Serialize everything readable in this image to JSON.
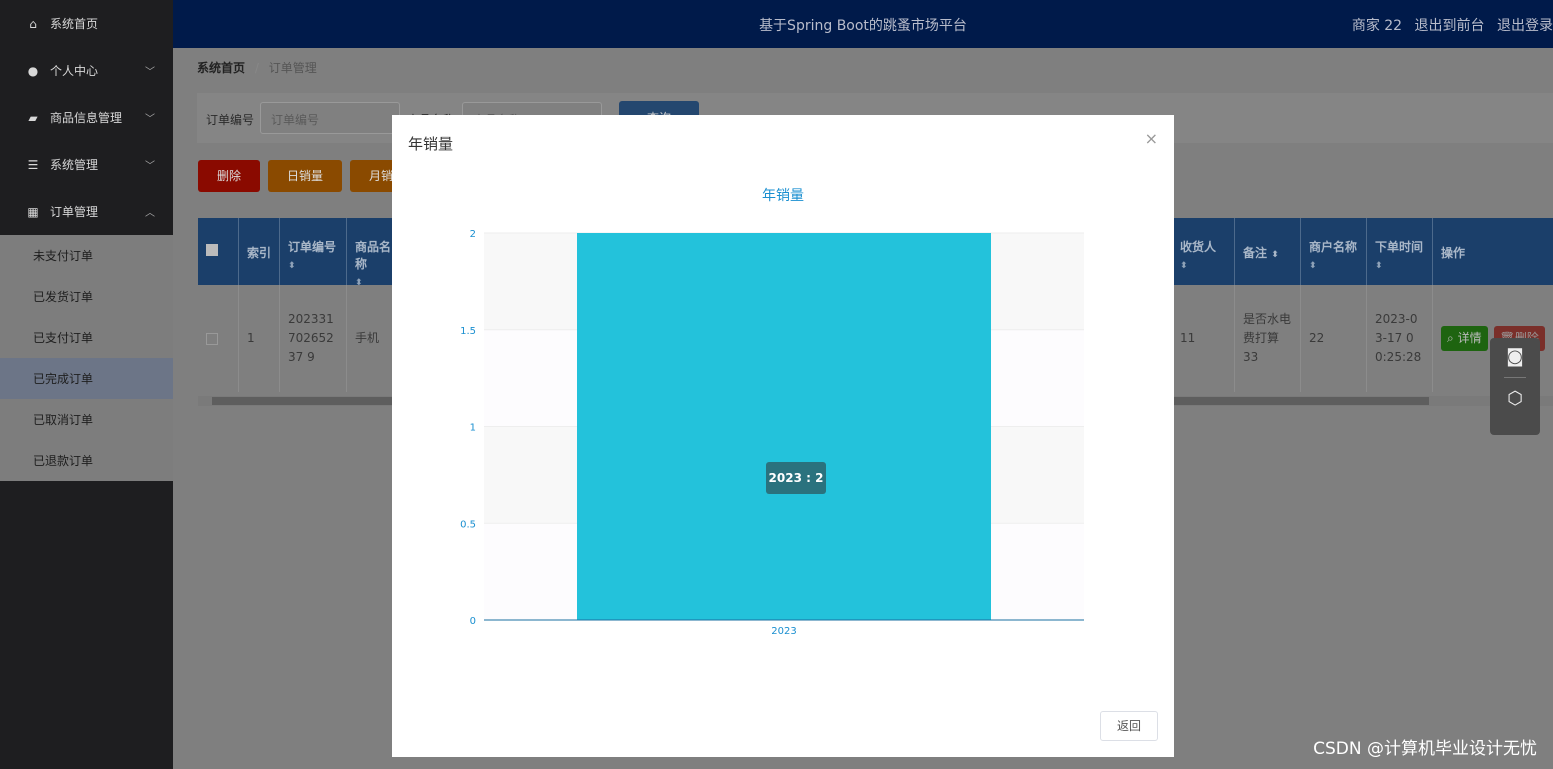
{
  "sidebar": {
    "items": [
      {
        "label": "系统首页",
        "icon": "home-icon",
        "expandable": false
      },
      {
        "label": "个人中心",
        "icon": "user-icon",
        "expandable": true
      },
      {
        "label": "商品信息管理",
        "icon": "chat-icon",
        "expandable": true
      },
      {
        "label": "系统管理",
        "icon": "sliders-icon",
        "expandable": true
      },
      {
        "label": "订单管理",
        "icon": "grid-icon",
        "expandable": true,
        "expanded": true
      }
    ],
    "submenu": [
      "未支付订单",
      "已发货订单",
      "已支付订单",
      "已完成订单",
      "已取消订单",
      "已退款订单"
    ],
    "active_submenu": "已完成订单"
  },
  "header": {
    "title": "基于Spring Boot的跳蚤市场平台",
    "user": "商家 22",
    "to_front": "退出到前台",
    "logout": "退出登录"
  },
  "breadcrumb": {
    "home": "系统首页",
    "sep": "/",
    "current": "订单管理"
  },
  "search": {
    "order_label": "订单编号",
    "order_placeholder": "订单编号",
    "name_label": "商品名称",
    "name_placeholder": "商品名称",
    "query_button": "查询"
  },
  "actions": {
    "delete": "删除",
    "daily": "日销量",
    "monthly": "月销量"
  },
  "table": {
    "columns_left": [
      "索引",
      "订单编号",
      "商品名称"
    ],
    "columns_right": [
      "收货人",
      "备注",
      "商户名称",
      "下单时间",
      "操作"
    ],
    "row": {
      "index": "1",
      "order_no": "20233170265237 9",
      "product": "手机",
      "receiver": "11",
      "remark": "是否水电费打算33",
      "merchant": "22",
      "time": "2023-03-17 00:25:28",
      "detail_button": "详情",
      "delete_button": "删除"
    }
  },
  "modal": {
    "title": "年销量",
    "return_button": "返回"
  },
  "chart_data": {
    "type": "bar",
    "title": "年销量",
    "categories": [
      "2023"
    ],
    "values": [
      2
    ],
    "ylim": [
      0,
      2
    ],
    "yticks": [
      "0",
      "0.5",
      "1",
      "1.5",
      "2"
    ],
    "grid": "split-area bands",
    "bar_color": "#23c2db",
    "tooltip": "2023 : 2"
  },
  "watermark": "CSDN @计算机毕业设计无忧"
}
